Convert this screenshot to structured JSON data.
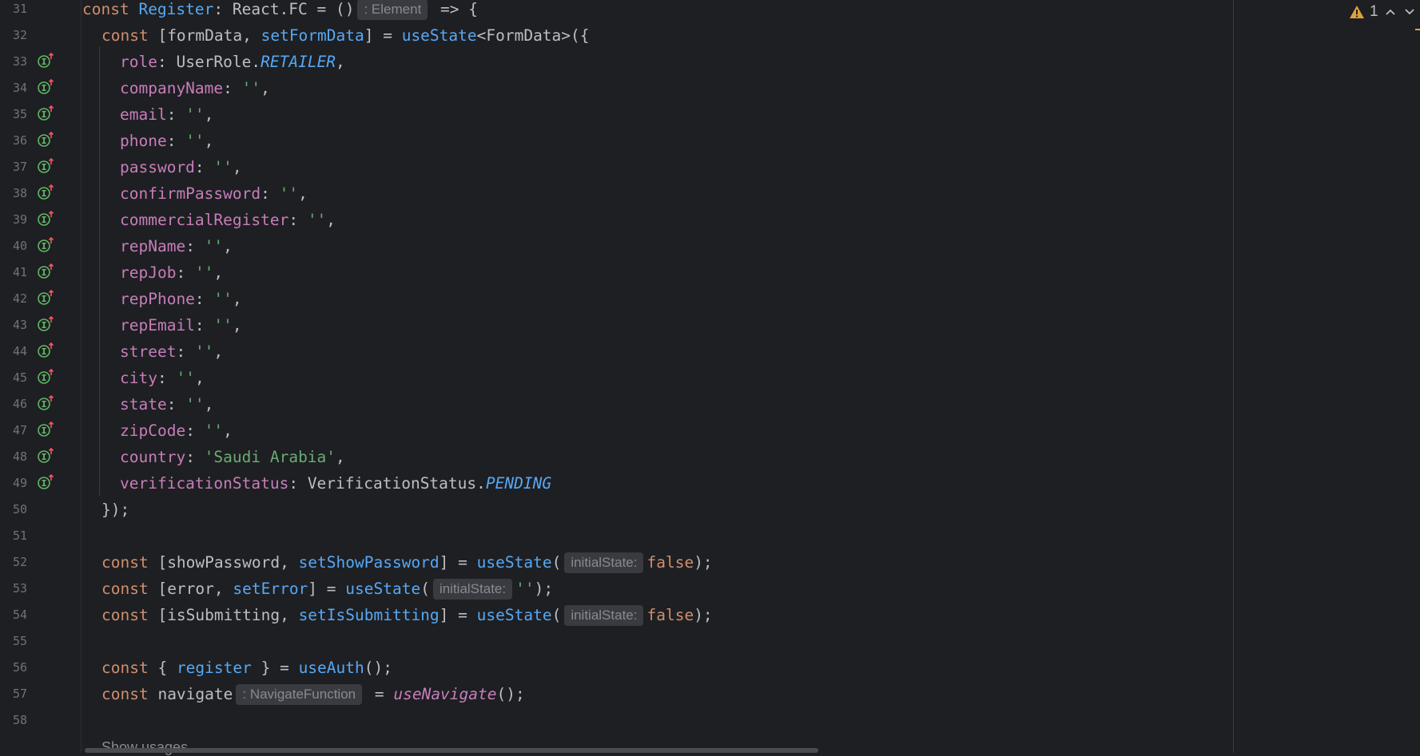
{
  "gutter": {
    "line_numbers": [
      "31",
      "32",
      "33",
      "34",
      "35",
      "36",
      "37",
      "38",
      "39",
      "40",
      "41",
      "42",
      "43",
      "44",
      "45",
      "46",
      "47",
      "48",
      "49",
      "50",
      "51",
      "52",
      "53",
      "54",
      "55",
      "56",
      "57",
      "58"
    ],
    "implements_icon_lines": [
      "33",
      "34",
      "35",
      "36",
      "37",
      "38",
      "39",
      "40",
      "41",
      "42",
      "43",
      "44",
      "45",
      "46",
      "47",
      "48",
      "49"
    ]
  },
  "code": {
    "l31": {
      "kw": "const ",
      "name": "Register",
      "mid": ": React.FC = ()",
      "hint": ": Element",
      "tail": " => {"
    },
    "l32": {
      "kw": "const ",
      "a": "[formData, ",
      "setter": "setFormData",
      "b": "] = ",
      "hook": "useState",
      "c": "<FormData>({"
    },
    "fields": [
      {
        "key": "role",
        "sep": ": ",
        "plain": "UserRole.",
        "ital": "RETAILER",
        "str": "",
        "end": ","
      },
      {
        "key": "companyName",
        "sep": ": ",
        "plain": "",
        "ital": "",
        "str": "''",
        "end": ","
      },
      {
        "key": "email",
        "sep": ": ",
        "plain": "",
        "ital": "",
        "str": "''",
        "end": ","
      },
      {
        "key": "phone",
        "sep": ": ",
        "plain": "",
        "ital": "",
        "str": "''",
        "end": ","
      },
      {
        "key": "password",
        "sep": ": ",
        "plain": "",
        "ital": "",
        "str": "''",
        "end": ","
      },
      {
        "key": "confirmPassword",
        "sep": ": ",
        "plain": "",
        "ital": "",
        "str": "''",
        "end": ","
      },
      {
        "key": "commercialRegister",
        "sep": ": ",
        "plain": "",
        "ital": "",
        "str": "''",
        "end": ","
      },
      {
        "key": "repName",
        "sep": ": ",
        "plain": "",
        "ital": "",
        "str": "''",
        "end": ","
      },
      {
        "key": "repJob",
        "sep": ": ",
        "plain": "",
        "ital": "",
        "str": "''",
        "end": ","
      },
      {
        "key": "repPhone",
        "sep": ": ",
        "plain": "",
        "ital": "",
        "str": "''",
        "end": ","
      },
      {
        "key": "repEmail",
        "sep": ": ",
        "plain": "",
        "ital": "",
        "str": "''",
        "end": ","
      },
      {
        "key": "street",
        "sep": ": ",
        "plain": "",
        "ital": "",
        "str": "''",
        "end": ","
      },
      {
        "key": "city",
        "sep": ": ",
        "plain": "",
        "ital": "",
        "str": "''",
        "end": ","
      },
      {
        "key": "state",
        "sep": ": ",
        "plain": "",
        "ital": "",
        "str": "''",
        "end": ","
      },
      {
        "key": "zipCode",
        "sep": ": ",
        "plain": "",
        "ital": "",
        "str": "''",
        "end": ","
      },
      {
        "key": "country",
        "sep": ": ",
        "plain": "",
        "ital": "",
        "str": "'Saudi Arabia'",
        "end": ","
      },
      {
        "key": "verificationStatus",
        "sep": ": ",
        "plain": "VerificationStatus.",
        "ital": "PENDING",
        "str": "",
        "end": ""
      }
    ],
    "l50": "});",
    "l52": {
      "kw": "const ",
      "a": "[showPassword, ",
      "setter": "setShowPassword",
      "b": "] = ",
      "hook": "useState",
      "c": "(",
      "hint": "initialState:",
      "val": "false",
      "d": ");"
    },
    "l53": {
      "kw": "const ",
      "a": "[error, ",
      "setter": "setError",
      "b": "] = ",
      "hook": "useState",
      "c": "(",
      "hint": "initialState:",
      "val": "''",
      "d": ");"
    },
    "l54": {
      "kw": "const ",
      "a": "[isSubmitting, ",
      "setter": "setIsSubmitting",
      "b": "] = ",
      "hook": "useState",
      "c": "(",
      "hint": "initialState:",
      "val": "false",
      "d": ");"
    },
    "l56": {
      "kw": "const ",
      "a": "{ ",
      "fn": "register",
      "b": " } = ",
      "hook": "useAuth",
      "c": "();"
    },
    "l57": {
      "kw": "const ",
      "a": "navigate",
      "hint": ": NavigateFunction",
      "b": " = ",
      "hook": "useNavigate",
      "c": "();"
    }
  },
  "status": {
    "warning_count": "1",
    "warning_icon": "warning-triangle-icon",
    "prev_icon": "chevron-up-icon",
    "next_icon": "chevron-down-icon"
  },
  "footer": {
    "show_usages": "Show usages"
  },
  "colors": {
    "background": "#1e1f22",
    "keyword": "#cf8e6d",
    "function": "#56a8f5",
    "property": "#c77dbb",
    "string": "#6aab73",
    "text": "#bcbec4",
    "line_number": "#6f737a",
    "hint_bg": "#393b40"
  }
}
